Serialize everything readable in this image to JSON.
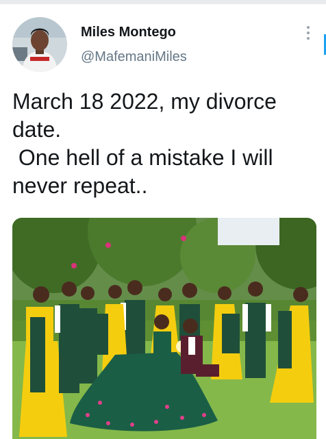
{
  "author": {
    "display_name": "Miles Montego",
    "handle": "@MafemaniMiles"
  },
  "tweet": {
    "text": "March 18 2022, my divorce\ndate.\n One hell of a mistake I will\nnever repeat.."
  },
  "icons": {
    "more": "more-vertical-icon"
  },
  "colors": {
    "text": "#14171a",
    "secondary": "#657786",
    "accent": "#1da1f2",
    "dress_yellow": "#f5cd0f",
    "suit_green": "#1f4f3a",
    "grass": "#84b84a"
  }
}
